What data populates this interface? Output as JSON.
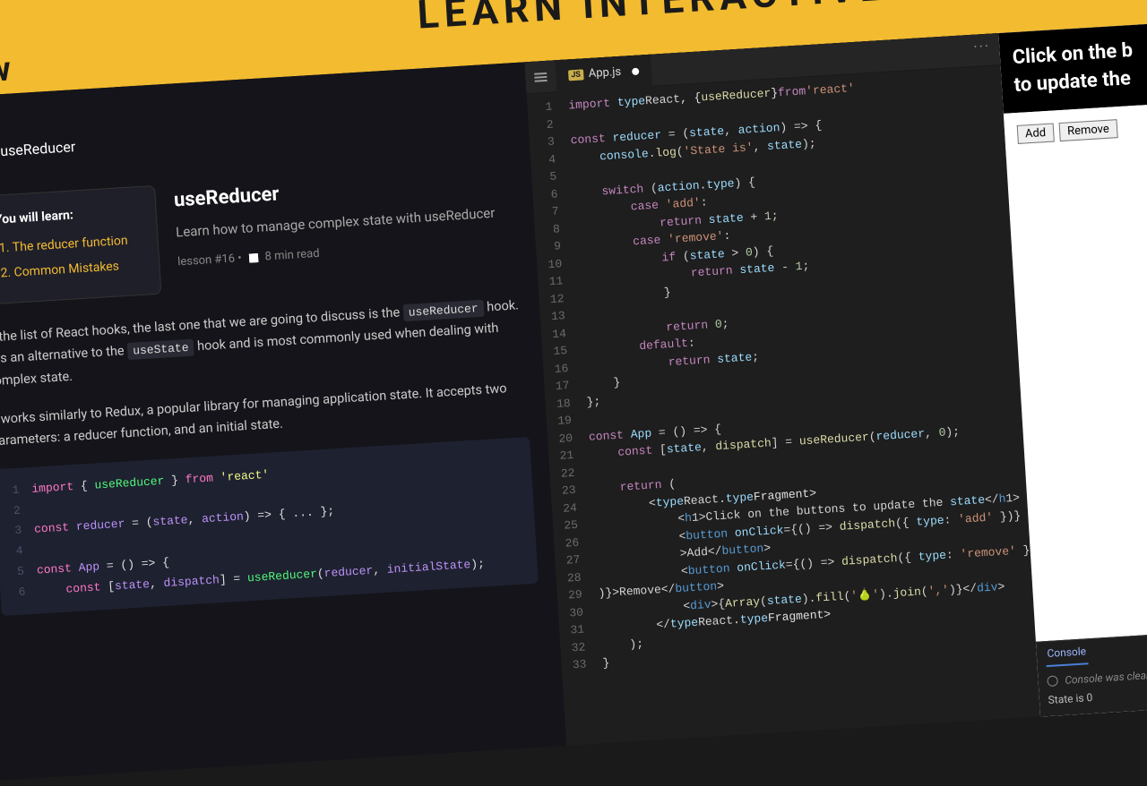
{
  "banner": {
    "text": "LEARN INTERACTIVELY",
    "logo": "Ww"
  },
  "lesson": {
    "breadcrumb_title": "useReducer",
    "title": "useReducer",
    "subtitle": "Learn how to manage complex state with useReducer",
    "meta": "lesson #16  •",
    "read_time": "8 min read",
    "learn_heading": "You will learn:",
    "learn_items": [
      "The reducer function",
      "Common Mistakes"
    ],
    "para1a": "In the list of React hooks, the last one that we are going to discuss is the",
    "code1": "useReducer",
    "para1b": "hook. It is an alternative to the",
    "code2": "useState",
    "para1c": "hook and is most commonly used when dealing with complex state.",
    "para2": "It works similarly to Redux, a popular library for managing application state. It accepts two parameters: a reducer function, and an initial state."
  },
  "snippet": [
    "import { useReducer } from 'react'",
    "",
    "const reducer = (state, action) => { ... };",
    "",
    "const App = () => {",
    "    const [state, dispatch] = useReducer(reducer, initialState);"
  ],
  "editor": {
    "filename": "App.js",
    "lines": [
      "import React, { useReducer } from 'react'",
      "",
      "const reducer = (state, action) => {",
      "    console.log('State is', state);",
      "",
      "    switch (action.type) {",
      "        case 'add':",
      "            return state + 1;",
      "        case 'remove':",
      "            if (state > 0) {",
      "                return state - 1;",
      "            }",
      "",
      "            return 0;",
      "        default:",
      "            return state;",
      "    }",
      "};",
      "",
      "const App = () => {",
      "    const [state, dispatch] = useReducer(reducer, 0);",
      "",
      "    return (",
      "        <React.Fragment>",
      "            <h1>Click on the buttons to update the state</h1>",
      "            <button onClick={() => dispatch({ type: 'add' })}",
      "            >Add</button>",
      "            <button onClick={() => dispatch({ type: 'remove' }",
      ")}>Remove</button>",
      "            <div>{Array(state).fill('🍐').join(',')}</div>",
      "        </React.Fragment>",
      "    );",
      "}"
    ]
  },
  "preview": {
    "heading_l1": "Click on the b",
    "heading_l2": "to update the",
    "button_add": "Add",
    "button_remove": "Remove"
  },
  "console": {
    "label": "Console",
    "cleared": "Console was cleared",
    "log": "State is 0"
  }
}
